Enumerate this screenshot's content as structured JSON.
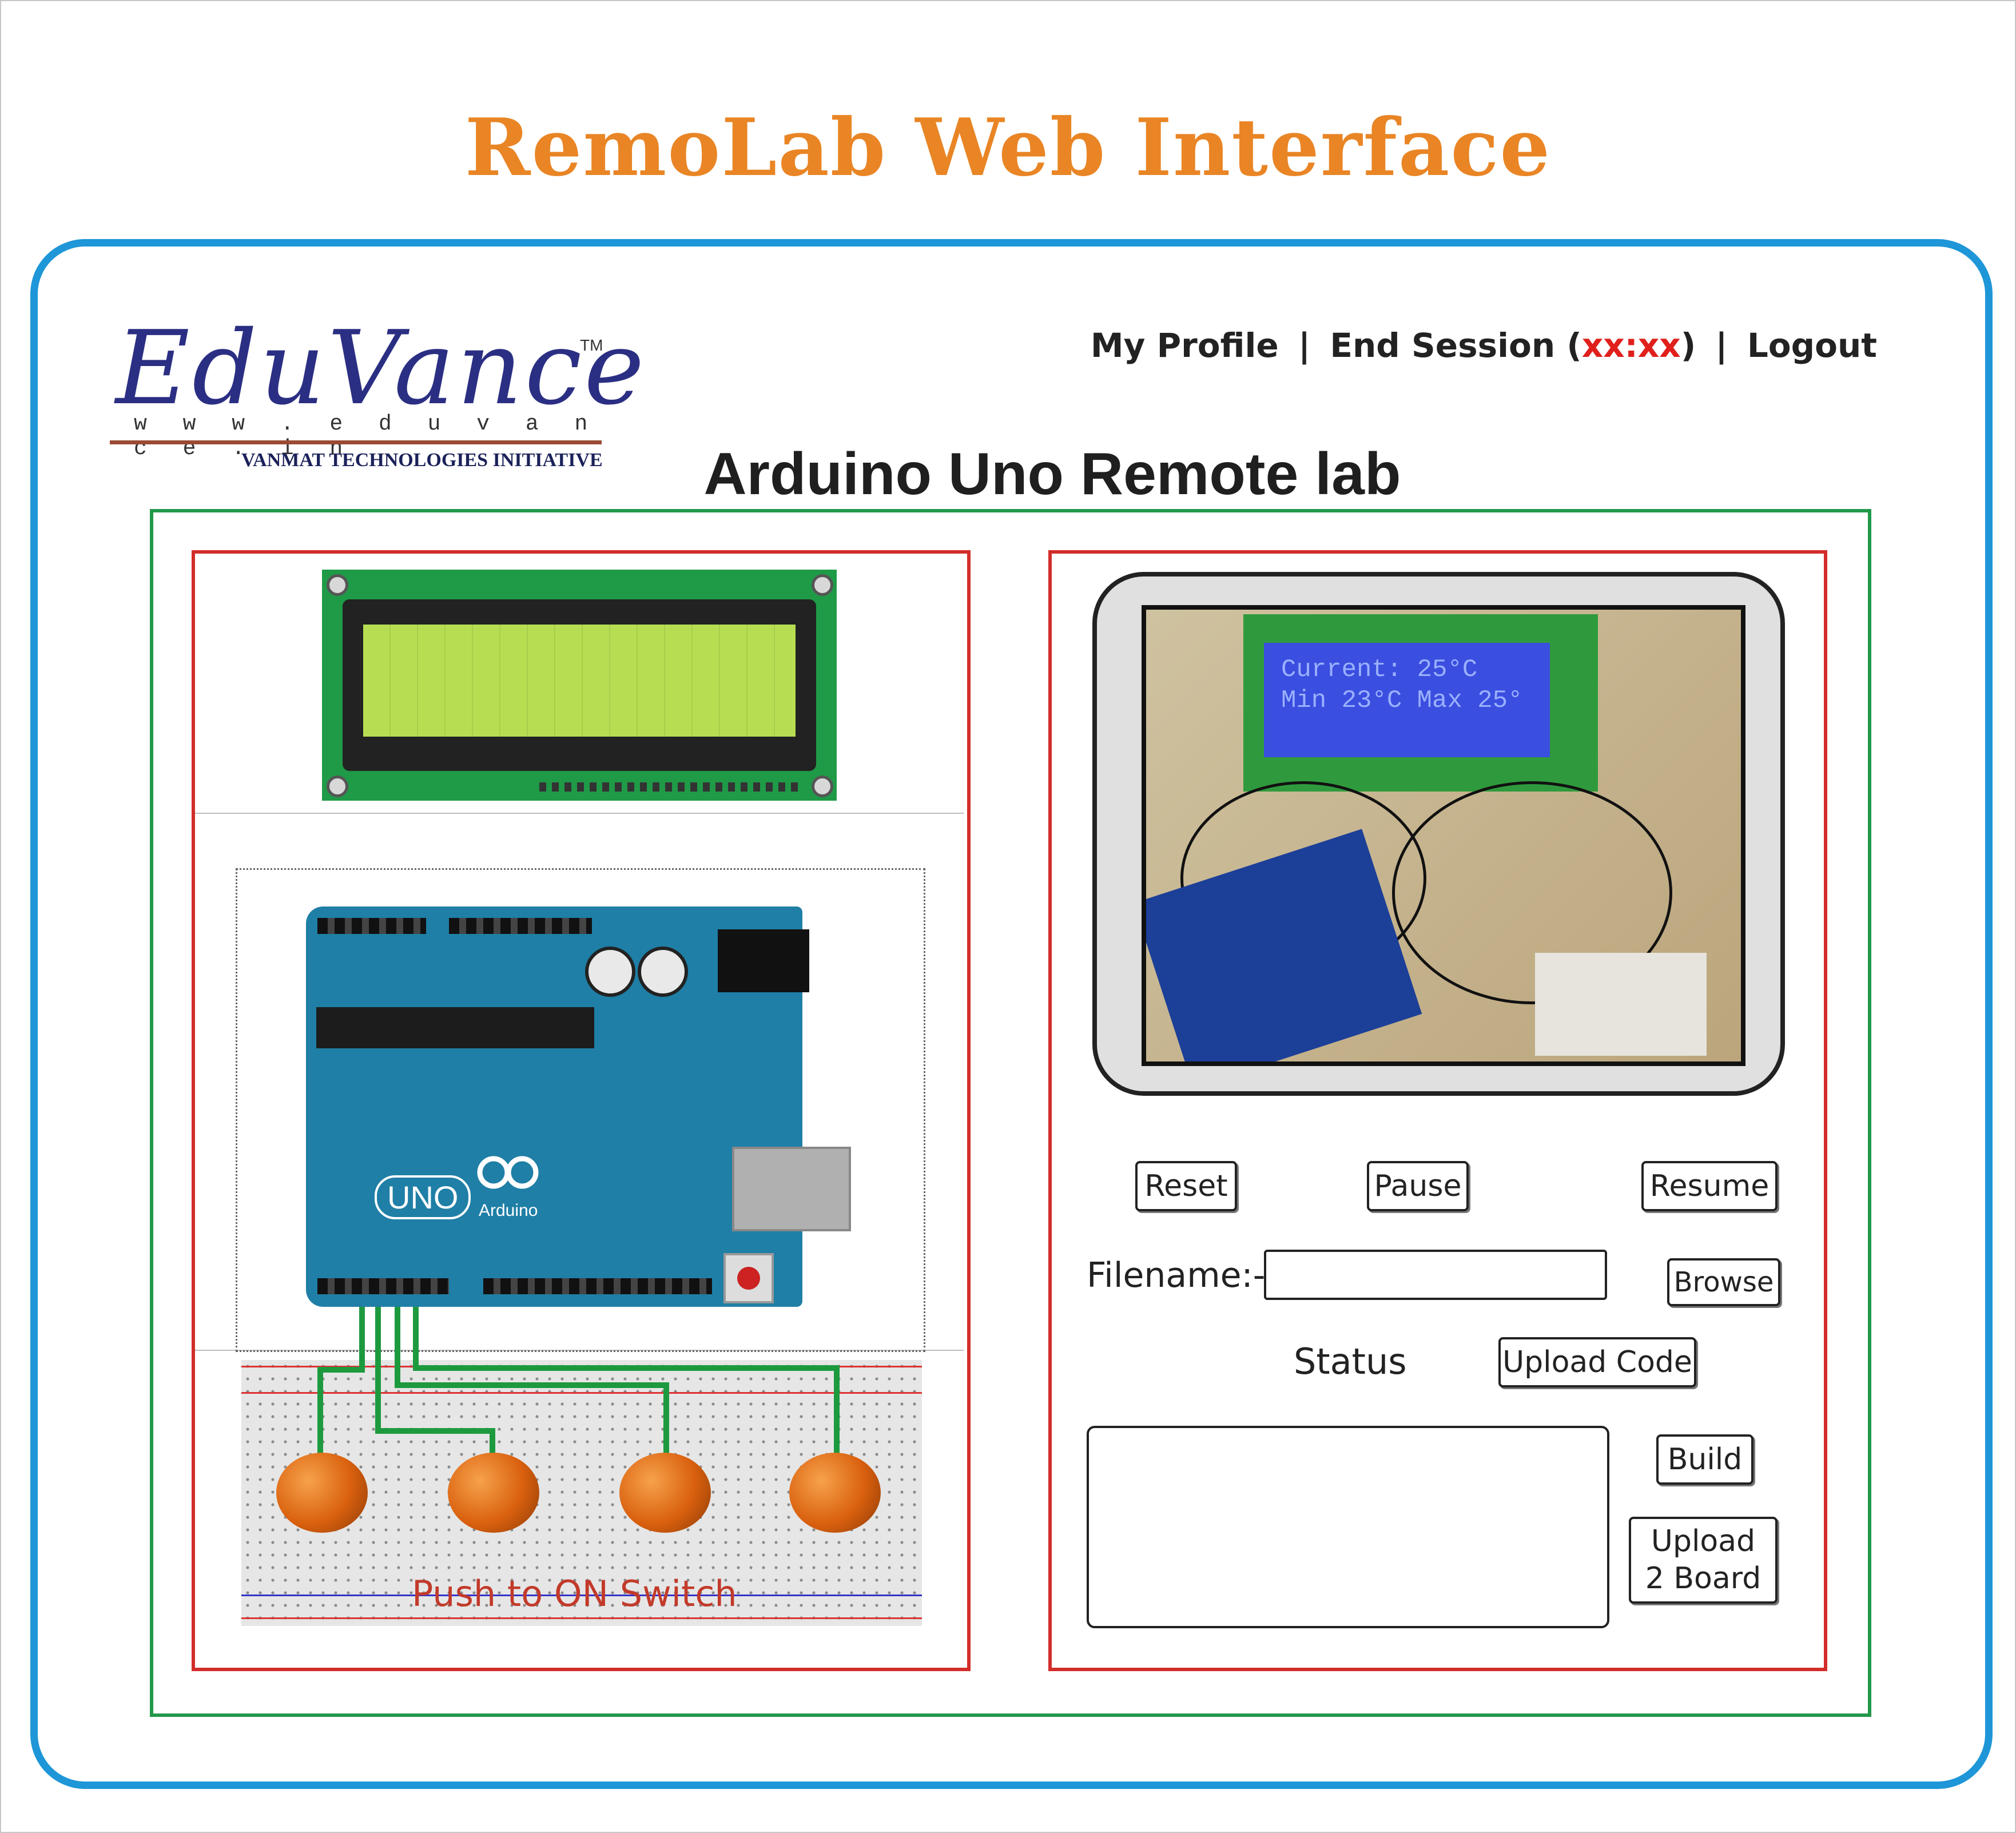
{
  "page": {
    "title": "RemoLab Web Interface"
  },
  "logo": {
    "brand": "EduVance",
    "trademark": "TM",
    "url": "w w w . e d u v a n c e . i n",
    "tagline": "VANMAT TECHNOLOGIES INITIATIVE"
  },
  "topnav": {
    "profile": "My Profile",
    "separator": "|",
    "end_session": "End Session",
    "timer_open": "(",
    "timer": "xx:xx",
    "timer_close": ")",
    "logout": "Logout"
  },
  "lab": {
    "title": "Arduino Uno Remote lab"
  },
  "left_panel": {
    "breadboard_label": "Push to ON Switch",
    "board_logo": "UNO",
    "board_brand": "Arduino"
  },
  "webcam": {
    "lcd_line1": "Current: 25°C",
    "lcd_line2": "Min 23°C Max 25°"
  },
  "controls": {
    "reset": "Reset",
    "pause": "Pause",
    "resume": "Resume",
    "filename_label": "Filename:-",
    "filename_value": "",
    "browse": "Browse",
    "status_label": "Status",
    "upload_code": "Upload Code",
    "build": "Build",
    "upload_board": "Upload 2 Board",
    "status_text": ""
  },
  "colors": {
    "title": "#e98525",
    "frame": "#1e96d7",
    "outer_box": "#22984a",
    "panels": "#d22d2a",
    "timer": "#e0201c"
  }
}
